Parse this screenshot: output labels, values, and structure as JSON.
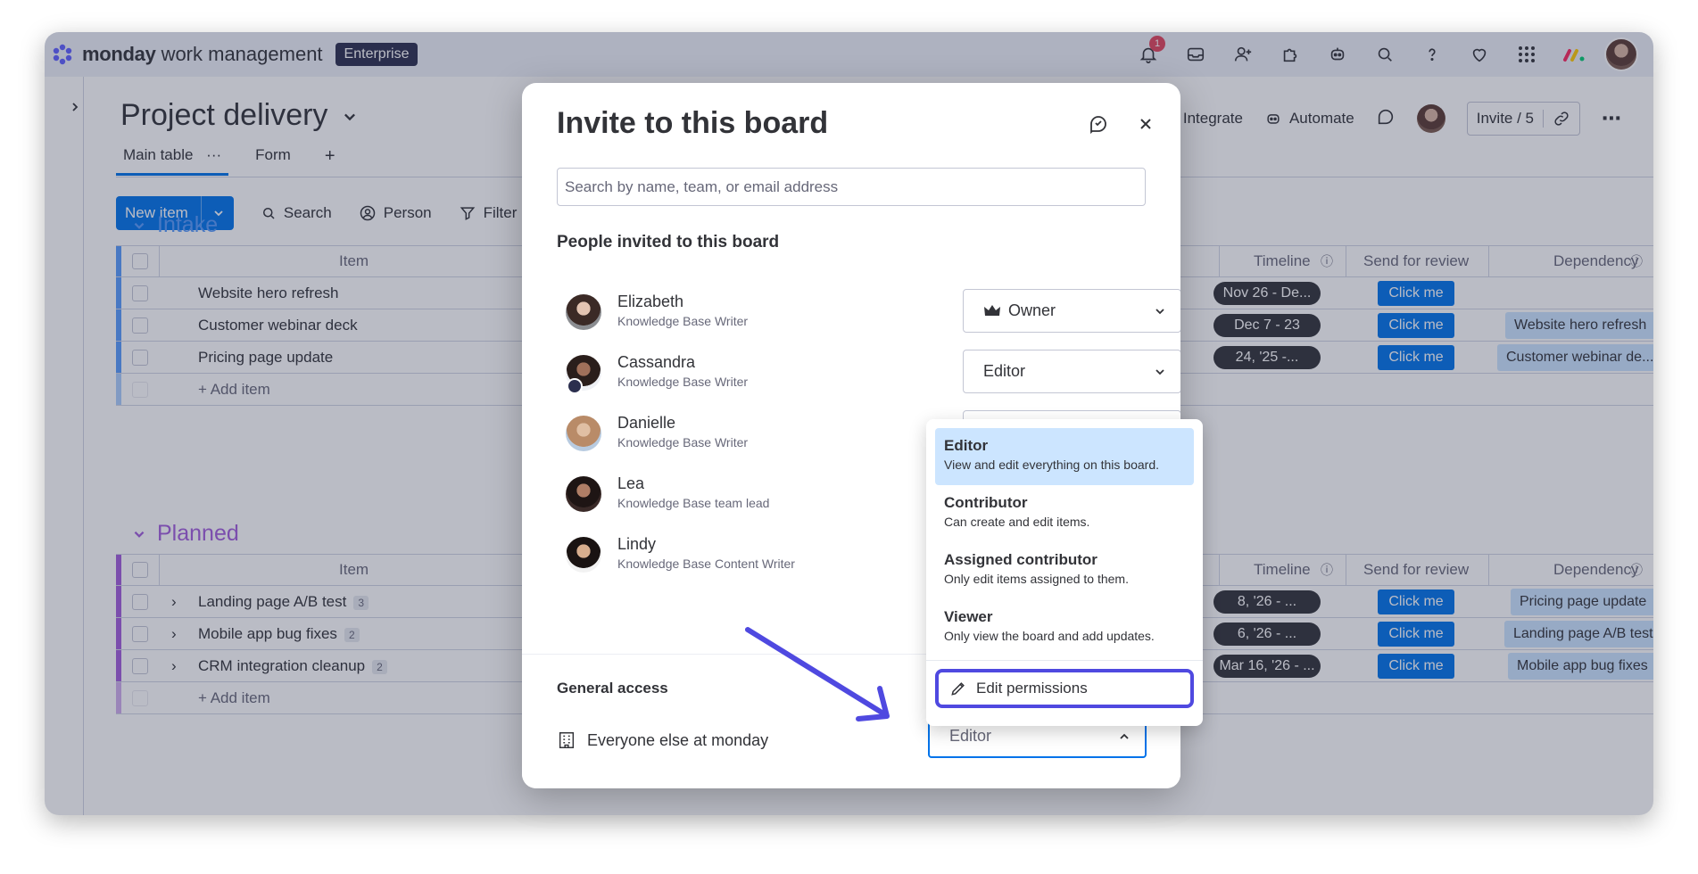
{
  "app": {
    "brand_bold": "monday",
    "brand_rest": "work management",
    "plan_badge": "Enterprise",
    "notification_count": "1"
  },
  "board": {
    "title": "Project delivery",
    "tabs": [
      "Main table",
      "Form"
    ],
    "toolbar": {
      "new_item": "New item",
      "search": "Search",
      "person": "Person",
      "filter": "Filter"
    },
    "header_actions": {
      "integrate": "Integrate",
      "automate": "Automate",
      "invite": "Invite / 5"
    },
    "columns": {
      "item": "Item",
      "timeline": "Timeline",
      "send_for_review": "Send for review",
      "dependency": "Dependency"
    },
    "groups": [
      {
        "name": "Intake",
        "color": "#579bfc",
        "rows": [
          {
            "item": "Website hero refresh",
            "count": "",
            "timeline": "Nov 26 - De...",
            "button": "Click me",
            "dependency": ""
          },
          {
            "item": "Customer webinar deck",
            "count": "",
            "timeline": "Dec 7 - 23",
            "button": "Click me",
            "dependency": "Website hero refresh"
          },
          {
            "item": "Pricing page update",
            "count": "",
            "timeline": "24, '25 -...",
            "button": "Click me",
            "dependency": "Customer webinar de..."
          }
        ],
        "add_item": "+ Add item"
      },
      {
        "name": "Planned",
        "color": "#a25ddc",
        "rows": [
          {
            "item": "Landing page A/B test",
            "count": "3",
            "timeline": "8, '26 - ...",
            "button": "Click me",
            "dependency": "Pricing page update"
          },
          {
            "item": "Mobile app bug fixes",
            "count": "2",
            "timeline": "6, '26 - ...",
            "button": "Click me",
            "dependency": "Landing page A/B test"
          },
          {
            "item": "CRM integration cleanup",
            "count": "2",
            "timeline": "Mar 16, '26 - ...",
            "button": "Click me",
            "dependency": "Mobile app bug fixes"
          }
        ],
        "add_item": "+ Add item"
      }
    ]
  },
  "modal": {
    "title": "Invite to this board",
    "search_placeholder": "Search by name, team, or email address",
    "people_label": "People invited to this board",
    "people": [
      {
        "name": "Elizabeth",
        "role": "Knowledge Base Writer",
        "permission": "Owner"
      },
      {
        "name": "Cassandra",
        "role": "Knowledge Base Writer",
        "permission": "Editor"
      },
      {
        "name": "Danielle",
        "role": "Knowledge Base Writer",
        "permission": ""
      },
      {
        "name": "Lea",
        "role": "Knowledge Base team lead",
        "permission": ""
      },
      {
        "name": "Lindy",
        "role": "Knowledge Base Content Writer",
        "permission": ""
      }
    ],
    "general_access_label": "General access",
    "general_access_scope": "Everyone else at monday",
    "general_access_value": "Editor"
  },
  "dropdown": {
    "options": [
      {
        "title": "Editor",
        "desc": "View and edit everything on this board."
      },
      {
        "title": "Contributor",
        "desc": "Can create and edit items."
      },
      {
        "title": "Assigned contributor",
        "desc": "Only edit items assigned to them."
      },
      {
        "title": "Viewer",
        "desc": "Only view the board and add updates."
      }
    ],
    "edit_permissions": "Edit permissions"
  },
  "colors": {
    "primary": "#0073ea",
    "highlight": "#4f49e0",
    "selected_bg": "#cce5ff"
  }
}
